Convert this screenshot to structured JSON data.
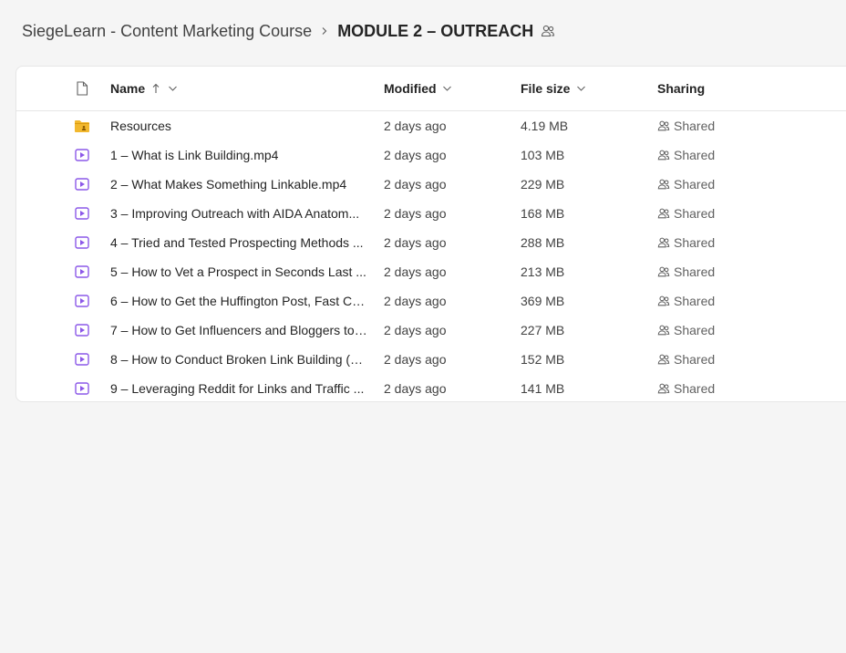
{
  "breadcrumb": {
    "parent": "SiegeLearn - Content Marketing Course",
    "current": "MODULE 2 – OUTREACH"
  },
  "columns": {
    "name": "Name",
    "modified": "Modified",
    "file_size": "File size",
    "sharing": "Sharing"
  },
  "icons": {
    "folder_color": "#f2b82e",
    "video_color": "#8c58e8"
  },
  "files": [
    {
      "type": "folder",
      "name": "Resources",
      "modified": "2 days ago",
      "size": "4.19 MB",
      "sharing": "Shared"
    },
    {
      "type": "video",
      "name": "1 – What is Link Building.mp4",
      "modified": "2 days ago",
      "size": "103 MB",
      "sharing": "Shared"
    },
    {
      "type": "video",
      "name": "2 – What Makes Something Linkable.mp4",
      "modified": "2 days ago",
      "size": "229 MB",
      "sharing": "Shared"
    },
    {
      "type": "video",
      "name": "3 – Improving Outreach with AIDA Anatom...",
      "modified": "2 days ago",
      "size": "168 MB",
      "sharing": "Shared"
    },
    {
      "type": "video",
      "name": "4 – Tried and Tested Prospecting Methods ...",
      "modified": "2 days ago",
      "size": "288 MB",
      "sharing": "Shared"
    },
    {
      "type": "video",
      "name": "5 – How to Vet a Prospect in Seconds Last ...",
      "modified": "2 days ago",
      "size": "213 MB",
      "sharing": "Shared"
    },
    {
      "type": "video",
      "name": "6 – How to Get the Huffington Post, Fast Co...",
      "modified": "2 days ago",
      "size": "369 MB",
      "sharing": "Shared"
    },
    {
      "type": "video",
      "name": "7 – How to Get Influencers and Bloggers to ...",
      "modified": "2 days ago",
      "size": "227 MB",
      "sharing": "Shared"
    },
    {
      "type": "video",
      "name": "8 – How to Conduct Broken Link Building (B...",
      "modified": "2 days ago",
      "size": "152 MB",
      "sharing": "Shared"
    },
    {
      "type": "video",
      "name": "9 – Leveraging Reddit for Links and Traffic ...",
      "modified": "2 days ago",
      "size": "141 MB",
      "sharing": "Shared"
    }
  ]
}
